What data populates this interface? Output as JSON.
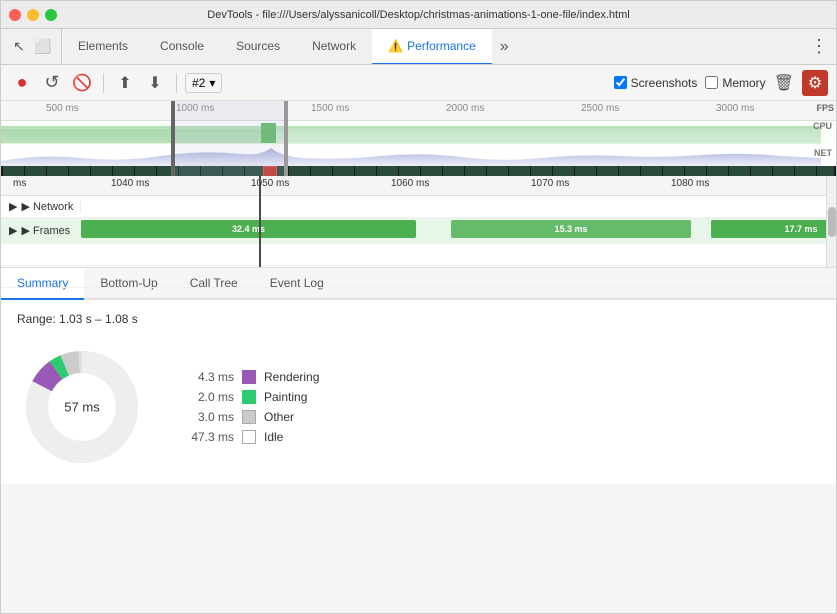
{
  "window": {
    "title": "DevTools - file:///Users/alyssanicoll/Desktop/christmas-animations-1-one-file/index.html"
  },
  "tabs": [
    {
      "id": "elements",
      "label": "Elements",
      "active": false
    },
    {
      "id": "console",
      "label": "Console",
      "active": false
    },
    {
      "id": "sources",
      "label": "Sources",
      "active": false
    },
    {
      "id": "network",
      "label": "Network",
      "active": false
    },
    {
      "id": "performance",
      "label": "Performance",
      "active": true
    }
  ],
  "toolbar": {
    "record_label": "●",
    "reload_label": "↺",
    "clear_label": "🚫",
    "upload_label": "↑",
    "download_label": "↓",
    "profile_label": "#2",
    "screenshots_label": "Screenshots",
    "memory_label": "Memory",
    "more_label": "⋮"
  },
  "timeline_ruler": {
    "ticks": [
      "500 ms",
      "1000 ms",
      "1500 ms",
      "2000 ms",
      "2500 ms",
      "3000 ms"
    ]
  },
  "detail_ruler": {
    "ticks": [
      "ms",
      "1040 ms",
      "1050 ms",
      "1060 ms",
      "1070 ms",
      "1080 ms"
    ]
  },
  "detail_rows": {
    "network_label": "▶ Network",
    "frames_label": "▶ Frames",
    "frames": [
      {
        "label": "32.4 ms",
        "left": "0%",
        "width": "33%"
      },
      {
        "label": "15.3 ms",
        "left": "36%",
        "width": "28%"
      },
      {
        "label": "17.7 ms",
        "left": "67%",
        "width": "28%"
      }
    ]
  },
  "bottom_tabs": [
    {
      "id": "summary",
      "label": "Summary",
      "active": true
    },
    {
      "id": "bottom-up",
      "label": "Bottom-Up",
      "active": false
    },
    {
      "id": "call-tree",
      "label": "Call Tree",
      "active": false
    },
    {
      "id": "event-log",
      "label": "Event Log",
      "active": false
    }
  ],
  "summary": {
    "range": "Range: 1.03 s – 1.08 s",
    "total": "57 ms",
    "items": [
      {
        "value": "4.3 ms",
        "color": "#9b59b6",
        "name": "Rendering"
      },
      {
        "value": "2.0 ms",
        "color": "#2ecc71",
        "name": "Painting"
      },
      {
        "value": "3.0 ms",
        "color": "#cccccc",
        "name": "Other"
      },
      {
        "value": "47.3 ms",
        "color": "#ffffff",
        "name": "Idle",
        "border": "#aaa"
      }
    ]
  },
  "labels": {
    "fps": "FPS",
    "cpu": "CPU",
    "net": "NET"
  }
}
